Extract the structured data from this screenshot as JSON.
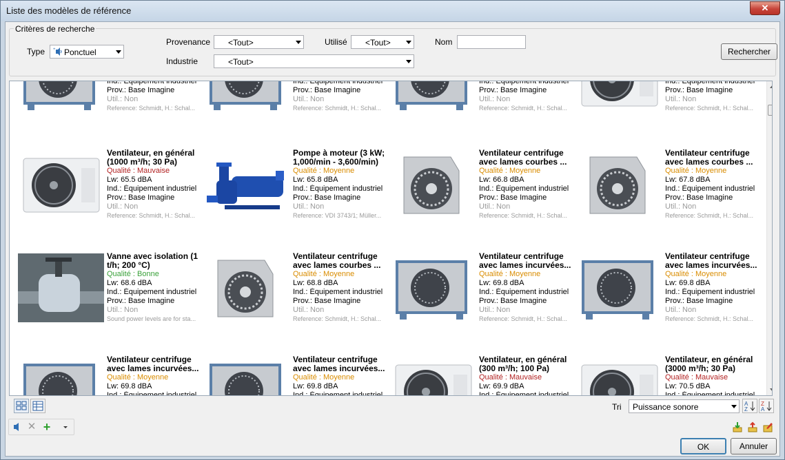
{
  "window": {
    "title": "Liste des modèles de référence",
    "close_label": "✕"
  },
  "criteria": {
    "legend": "Critères de recherche",
    "type_label": "Type",
    "type_value": "Ponctuel",
    "provenance_label": "Provenance",
    "provenance_value": "<Tout>",
    "utilise_label": "Utilisé",
    "utilise_value": "<Tout>",
    "nom_label": "Nom",
    "nom_value": "",
    "industrie_label": "Industrie",
    "industrie_value": "<Tout>",
    "search_button": "Rechercher"
  },
  "cards_top_partial": [
    {
      "ind": "Ind.: Équipement industriel",
      "prov": "Prov.: Base Imagine",
      "util": "Util.: Non",
      "ref": "Reference: Schmidt, H.: Schal..."
    },
    {
      "ind": "Ind.: Équipement industriel",
      "prov": "Prov.: Base Imagine",
      "util": "Util.: Non",
      "ref": "Reference: Schmidt, H.: Schal..."
    },
    {
      "ind": "Ind.: Équipement industriel",
      "prov": "Prov.: Base Imagine",
      "util": "Util.: Non",
      "ref": "Reference: Schmidt, H.: Schal..."
    },
    {
      "ind": "Ind.: Équipement industriel",
      "prov": "Prov.: Base Imagine",
      "util": "Util.: Non",
      "ref": "Reference: Schmidt, H.: Schal..."
    }
  ],
  "cards_row2": [
    {
      "title": "Ventilateur, en général (1000 m³/h; 30 Pa)",
      "quality": "Qualité : Mauvaise",
      "lw": "Lw: 65.5 dBA",
      "ind": "Ind.: Équipement industriel",
      "prov": "Prov.: Base Imagine",
      "util": "Util.: Non",
      "ref": "Reference: Schmidt, H.: Schal...",
      "img": "ac"
    },
    {
      "title": "Pompe à moteur (3 kW; 1,000/min - 3,600/min)",
      "quality": "Qualité : Moyenne",
      "lw": "Lw: 65.8 dBA",
      "ind": "Ind.: Équipement industriel",
      "prov": "Prov.: Base Imagine",
      "util": "Util.: Non",
      "ref": "Reference: VDI 3743/1; Müller...",
      "img": "pump"
    },
    {
      "title": "Ventilateur centrifuge avec lames courbes ...",
      "quality": "Qualité : Moyenne",
      "lw": "Lw: 66.8 dBA",
      "ind": "Ind.: Équipement industriel",
      "prov": "Prov.: Base Imagine",
      "util": "Util.: Non",
      "ref": "Reference: Schmidt, H.: Schal...",
      "img": "fan"
    },
    {
      "title": "Ventilateur centrifuge avec lames courbes ...",
      "quality": "Qualité : Moyenne",
      "lw": "Lw: 67.8 dBA",
      "ind": "Ind.: Équipement industriel",
      "prov": "Prov.: Base Imagine",
      "util": "Util.: Non",
      "ref": "Reference: Schmidt, H.: Schal...",
      "img": "fan"
    }
  ],
  "cards_row3": [
    {
      "title": "Vanne avec isolation (1 t/h; 200 °C)",
      "quality": "Qualité : Bonne",
      "lw": "Lw: 68.6 dBA",
      "ind": "Ind.: Équipement industriel",
      "prov": "Prov.: Base Imagine",
      "util": "Util.: Non",
      "ref": "Sound power levels are for sta...",
      "img": "valve"
    },
    {
      "title": "Ventilateur centrifuge avec lames courbes ...",
      "quality": "Qualité : Moyenne",
      "lw": "Lw: 68.8 dBA",
      "ind": "Ind.: Équipement industriel",
      "prov": "Prov.: Base Imagine",
      "util": "Util.: Non",
      "ref": "Reference: Schmidt, H.: Schal...",
      "img": "fan"
    },
    {
      "title": "Ventilateur centrifuge avec lames incurvées...",
      "quality": "Qualité : Moyenne",
      "lw": "Lw: 69.8 dBA",
      "ind": "Ind.: Équipement industriel",
      "prov": "Prov.: Base Imagine",
      "util": "Util.: Non",
      "ref": "Reference: Schmidt, H.: Schal...",
      "img": "box"
    },
    {
      "title": "Ventilateur centrifuge avec lames incurvées...",
      "quality": "Qualité : Moyenne",
      "lw": "Lw: 69.8 dBA",
      "ind": "Ind.: Équipement industriel",
      "prov": "Prov.: Base Imagine",
      "util": "Util.: Non",
      "ref": "Reference: Schmidt, H.: Schal...",
      "img": "box"
    }
  ],
  "cards_row4": [
    {
      "title": "Ventilateur centrifuge avec lames incurvées...",
      "quality": "Qualité : Moyenne",
      "lw": "Lw: 69.8 dBA",
      "ind": "Ind.: Équipement industriel",
      "img": "box"
    },
    {
      "title": "Ventilateur centrifuge avec lames incurvées...",
      "quality": "Qualité : Moyenne",
      "lw": "Lw: 69.8 dBA",
      "ind": "Ind.: Équipement industriel",
      "img": "box"
    },
    {
      "title": "Ventilateur, en général (300 m³/h; 100 Pa)",
      "quality": "Qualité : Mauvaise",
      "lw": "Lw: 69.9 dBA",
      "ind": "Ind.: Équipement industriel",
      "img": "ac"
    },
    {
      "title": "Ventilateur, en général (3000 m³/h; 30 Pa)",
      "quality": "Qualité : Mauvaise",
      "lw": "Lw: 70.5 dBA",
      "ind": "Ind.: Équipement industriel",
      "img": "ac"
    }
  ],
  "sort": {
    "label": "Tri",
    "value": "Puissance sonore"
  },
  "footer": {
    "ok": "OK",
    "cancel": "Annuler"
  }
}
